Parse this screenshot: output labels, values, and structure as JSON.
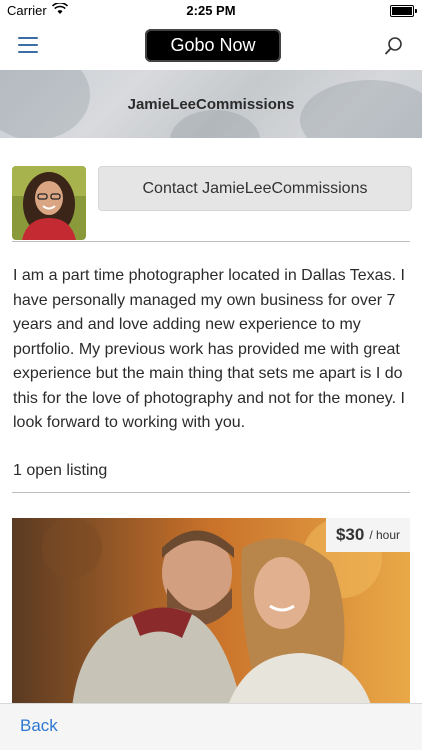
{
  "status_bar": {
    "carrier": "Carrier",
    "time": "2:25 PM"
  },
  "nav": {
    "logo": "Gobo Now",
    "menu_icon": "hamburger-menu-icon",
    "search_icon": "search-icon"
  },
  "banner": {
    "title": "JamieLeeCommissions"
  },
  "profile": {
    "contact_label": "Contact JamieLeeCommissions"
  },
  "bio": "I am a part time photographer located in Dallas Texas. I have personally managed my own business for over 7 years and and love adding new experience to my portfolio. My previous work has provided me with great experience but the main thing that sets me apart is I do this for the love of photography and not for the money. I look forward to working with you.",
  "listings": {
    "count_label": "1 open listing",
    "items": [
      {
        "price": "$30",
        "unit": "/ hour"
      }
    ]
  },
  "bottom": {
    "back_label": "Back"
  },
  "colors": {
    "accent": "#2f78d1",
    "menu": "#3a6ea5",
    "logo_bg": "#000000"
  }
}
